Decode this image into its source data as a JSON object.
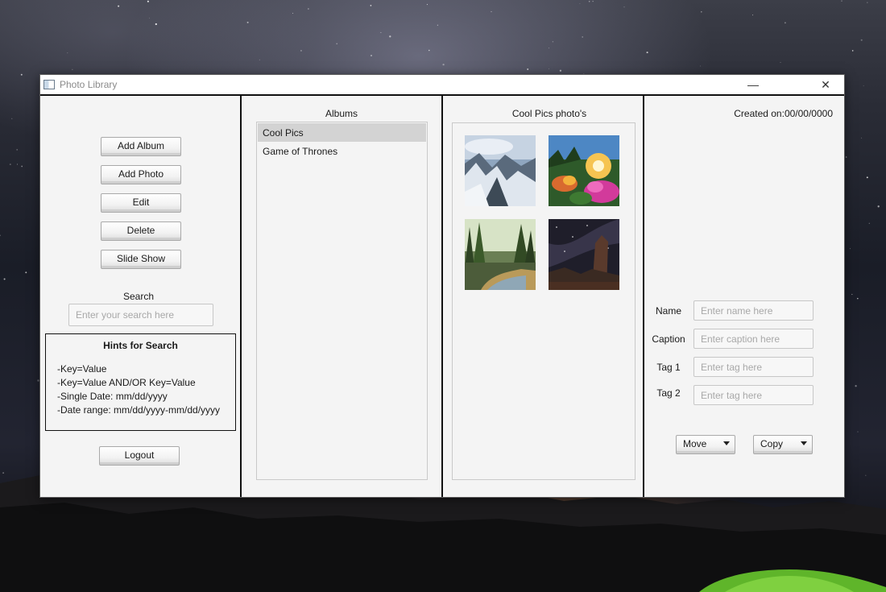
{
  "window": {
    "title": "Photo Library",
    "minimize_glyph": "—",
    "close_glyph": "✕"
  },
  "left_panel": {
    "buttons": {
      "add_album": "Add Album",
      "add_photo": "Add Photo",
      "edit": "Edit",
      "delete": "Delete",
      "slide_show": "Slide Show",
      "logout": "Logout"
    },
    "search_label": "Search",
    "search_placeholder": "Enter your search here",
    "hints": {
      "title": "Hints for Search",
      "lines": [
        "-Key=Value",
        "-Key=Value AND/OR Key=Value",
        "-Single Date: mm/dd/yyyy",
        "-Date range: mm/dd/yyyy-mm/dd/yyyy"
      ]
    }
  },
  "albums_panel": {
    "header": "Albums",
    "items": [
      {
        "label": "Cool Pics",
        "selected": true
      },
      {
        "label": "Game of Thrones",
        "selected": false
      }
    ]
  },
  "photos_panel": {
    "header": "Cool Pics photo's",
    "photos": [
      {
        "icon": "snowy-mountain-photo"
      },
      {
        "icon": "flowers-sunset-photo"
      },
      {
        "icon": "forest-river-photo"
      },
      {
        "icon": "night-sky-rock-photo"
      }
    ]
  },
  "detail_panel": {
    "created_on": "Created on:00/00/0000",
    "name_label": "Name",
    "name_placeholder": "Enter name here",
    "caption_label": "Caption",
    "caption_placeholder": "Enter caption here",
    "tag1_label": "Tag 1",
    "tag1_placeholder": "Enter tag here",
    "tag2_label": "Tag 2",
    "tag2_placeholder": "Enter tag here",
    "move_label": "Move",
    "copy_label": "Copy"
  },
  "colors": {
    "window_bg": "#f4f4f4",
    "selected_item": "#d3d3d3",
    "divider": "#111111"
  }
}
